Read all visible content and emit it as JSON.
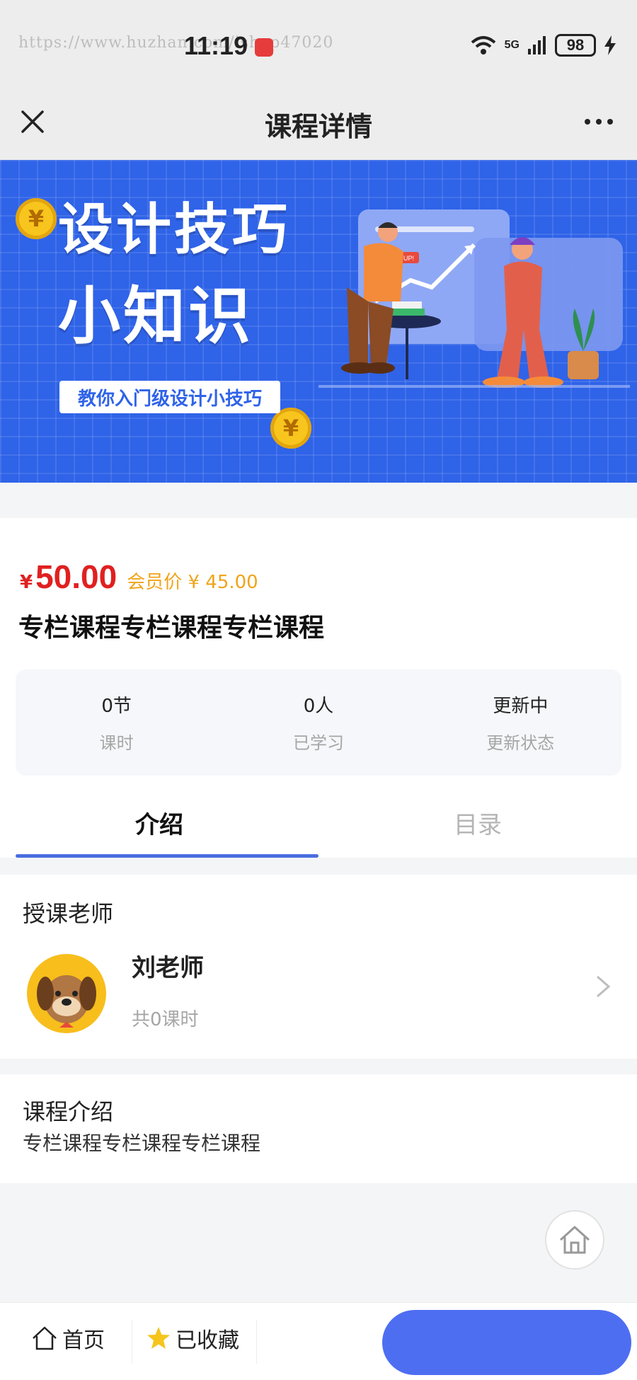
{
  "status_bar": {
    "url": "https://www.huzhan.com/ishop47020",
    "time": "11:19",
    "network": "5G",
    "battery": "98"
  },
  "nav": {
    "title": "课程详情"
  },
  "banner": {
    "title_line1": "设计技巧",
    "title_line2": "小知识",
    "subtitle": "教你入门级设计小技巧",
    "coin_symbol": "¥",
    "badge": "UP!"
  },
  "course": {
    "price_symbol": "¥",
    "price": "50.00",
    "member_price": "会员价 ¥ 45.00",
    "title": "专栏课程专栏课程专栏课程"
  },
  "stats": [
    {
      "value": "0节",
      "label": "课时"
    },
    {
      "value": "0人",
      "label": "已学习"
    },
    {
      "value": "更新中",
      "label": "更新状态"
    }
  ],
  "tabs": [
    {
      "label": "介绍",
      "active": true
    },
    {
      "label": "目录",
      "active": false
    }
  ],
  "teacher": {
    "heading": "授课老师",
    "name": "刘老师",
    "lessons": "共0课时"
  },
  "intro": {
    "heading": "课程介绍",
    "text": "专栏课程专栏课程专栏课程"
  },
  "bottom_bar": {
    "home_label": "首页",
    "favorite_label": "已收藏",
    "buy_label": ""
  },
  "colors": {
    "accent": "#4e6ef2",
    "price": "#e02020",
    "member_price": "#f0a41a",
    "banner_bg": "#2f63e8"
  },
  "icons": [
    "close-icon",
    "more-icon",
    "chevron-right-icon",
    "home-icon",
    "star-icon",
    "wifi-icon",
    "signal-icon",
    "battery-icon"
  ]
}
